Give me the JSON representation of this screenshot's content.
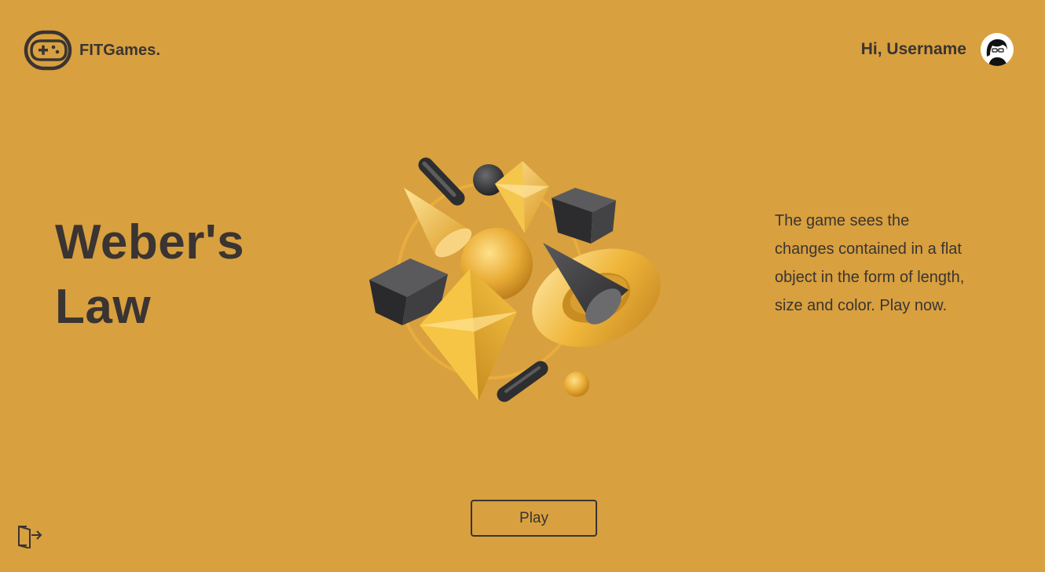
{
  "header": {
    "brand_name": "FITGames.",
    "greeting": "Hi, Username"
  },
  "game": {
    "title": "Weber's Law",
    "description": "The game sees the changes contained in a flat object in the form of length, size and color. Play now."
  },
  "actions": {
    "play_label": "Play"
  },
  "icons": {
    "logo": "gamepad-icon",
    "avatar": "user-avatar",
    "logout": "logout-icon"
  },
  "colors": {
    "background": "#d8a03e",
    "text": "#3a3432",
    "accent_gold": "#f2c24a",
    "dark_shape": "#3b3b3d"
  }
}
